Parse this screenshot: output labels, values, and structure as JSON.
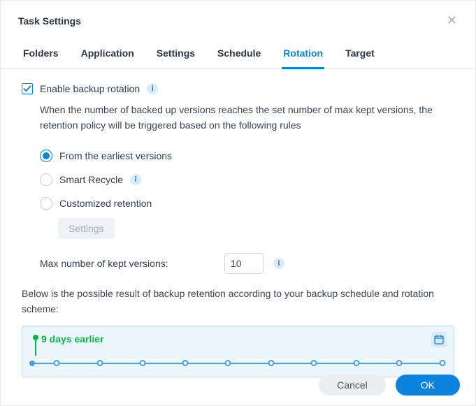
{
  "dialog": {
    "title": "Task Settings"
  },
  "tabs": {
    "folders": "Folders",
    "application": "Application",
    "settings": "Settings",
    "schedule": "Schedule",
    "rotation": "Rotation",
    "target": "Target"
  },
  "rotation": {
    "enable_label": "Enable backup rotation",
    "description": "When the number of backed up versions reaches the set number of max kept versions, the retention policy will be triggered based on the following rules",
    "option_earliest": "From the earliest versions",
    "option_smart": "Smart Recycle",
    "option_custom": "Customized retention",
    "settings_button": "Settings",
    "max_label": "Max number of kept versions:",
    "max_value": "10",
    "below_desc": "Below is the possible result of backup retention according to your backup schedule and rotation scheme:",
    "timeline_label": "9 days earlier"
  },
  "buttons": {
    "cancel": "Cancel",
    "ok": "OK"
  },
  "colors": {
    "accent": "#0b84e0",
    "green": "#10b24b",
    "timeline": "#4a9fe3",
    "panel_bg": "#edf6fd"
  }
}
